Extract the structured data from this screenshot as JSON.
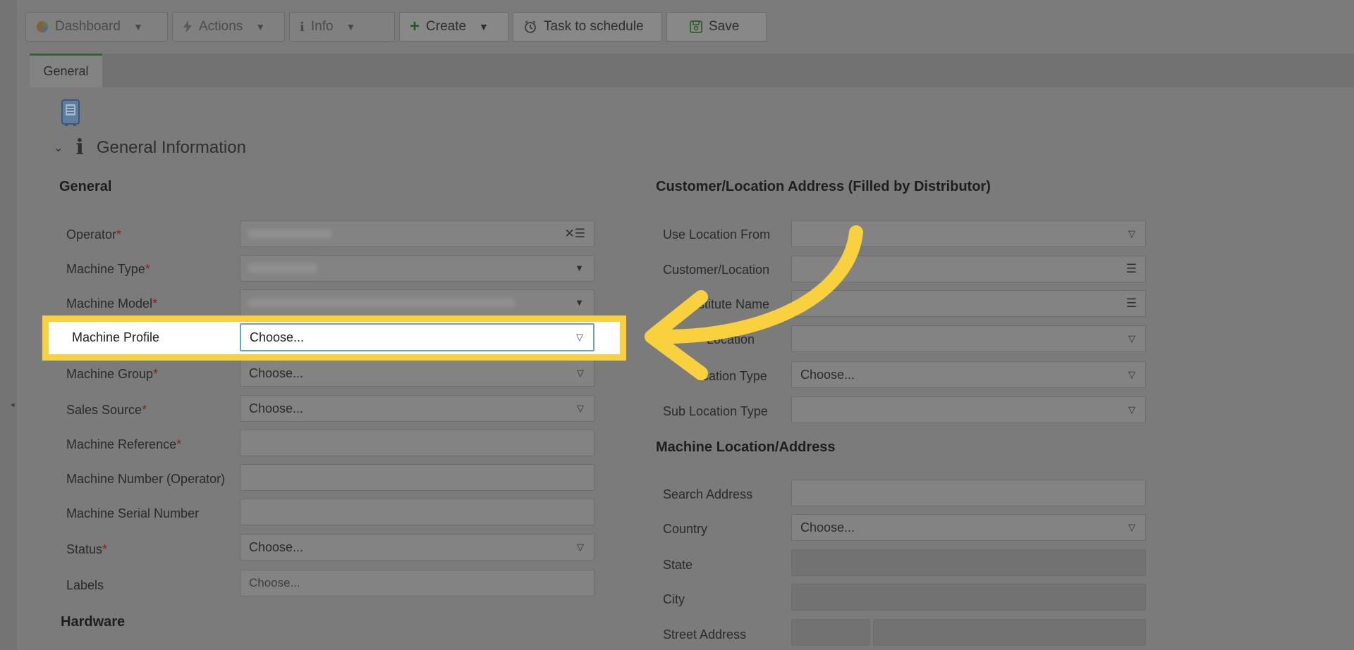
{
  "toolbar": {
    "dashboard": "Dashboard",
    "actions": "Actions",
    "info": "Info",
    "create": "Create",
    "task": "Task to schedule",
    "save": "Save"
  },
  "tabs": {
    "general": "General"
  },
  "section": {
    "title": "General Information"
  },
  "left": {
    "group_title": "General",
    "fields": [
      {
        "label": "Operator",
        "required": true,
        "value": ""
      },
      {
        "label": "Machine Type",
        "required": true,
        "value": ""
      },
      {
        "label": "Machine Model",
        "required": true,
        "value": ""
      },
      {
        "label": "Machine Profile",
        "required": false,
        "value": "Choose..."
      },
      {
        "label": "Machine Group",
        "required": true,
        "value": "Choose..."
      },
      {
        "label": "Sales Source",
        "required": true,
        "value": "Choose..."
      },
      {
        "label": "Machine Reference",
        "required": true,
        "value": ""
      },
      {
        "label": "Machine Number (Operator)",
        "required": false,
        "value": ""
      },
      {
        "label": "Machine Serial Number",
        "required": false,
        "value": ""
      },
      {
        "label": "Status",
        "required": true,
        "value": "Choose..."
      },
      {
        "label": "Labels",
        "required": false,
        "placeholder": "Choose..."
      }
    ],
    "hardware_title": "Hardware"
  },
  "right": {
    "group_title": "Customer/Location Address (Filled by Distributor)",
    "fields": [
      {
        "label": "Use Location From",
        "value": ""
      },
      {
        "label": "Customer/Location",
        "value": ""
      },
      {
        "label": "stitute Name",
        "value": ""
      },
      {
        "label": "Location",
        "value": ""
      },
      {
        "label": "cation Type",
        "value": "Choose..."
      },
      {
        "label": "Sub Location Type",
        "value": ""
      }
    ],
    "address_title": "Machine Location/Address",
    "address_fields": [
      {
        "label": "Search Address",
        "value": ""
      },
      {
        "label": "Country",
        "value": "Choose..."
      },
      {
        "label": "State",
        "value": ""
      },
      {
        "label": "City",
        "value": ""
      },
      {
        "label": "Street Address",
        "value": ""
      }
    ]
  },
  "colors": {
    "highlight": "#f9d13e",
    "arrow": "#f9d13e",
    "tab_accent": "#2c6b2c"
  },
  "icons": [
    "pie-chart-icon",
    "lightning-icon",
    "info-icon",
    "plus-icon",
    "alarm-clock-icon",
    "save-icon",
    "device-icon",
    "chevron-down-icon",
    "dropdown-triangle-icon",
    "list-icon",
    "clear-icon",
    "arrow-annotation"
  ]
}
